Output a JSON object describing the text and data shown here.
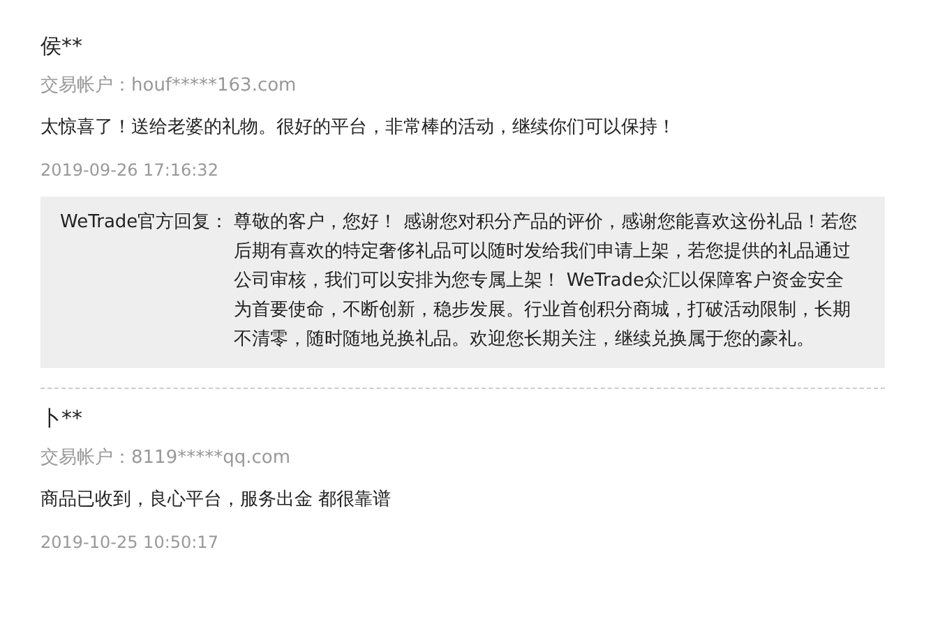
{
  "reviews": [
    {
      "name": "侯**",
      "account": "交易帐户：houf*****163.com",
      "comment": "太惊喜了！送给老婆的礼物。很好的平台，非常棒的活动，继续你们可以保持！",
      "time": "2019-09-26 17:16:32",
      "reply": {
        "label": "WeTrade官方回复：",
        "text": "尊敬的客户，您好！ 感谢您对积分产品的评价，感谢您能喜欢这份礼品！若您后期有喜欢的特定奢侈礼品可以随时发给我们申请上架，若您提供的礼品通过公司审核，我们可以安排为您专属上架！ WeTrade众汇以保障客户资金安全为首要使命，不断创新，稳步发展。行业首创积分商城，打破活动限制，长期不清零，随时随地兑换礼品。欢迎您长期关注，继续兑换属于您的豪礼。"
      }
    },
    {
      "name": "卜**",
      "account": "交易帐户：8119*****qq.com",
      "comment": "商品已收到，良心平台，服务出金 都很靠谱",
      "time": "2019-10-25 10:50:17"
    }
  ]
}
